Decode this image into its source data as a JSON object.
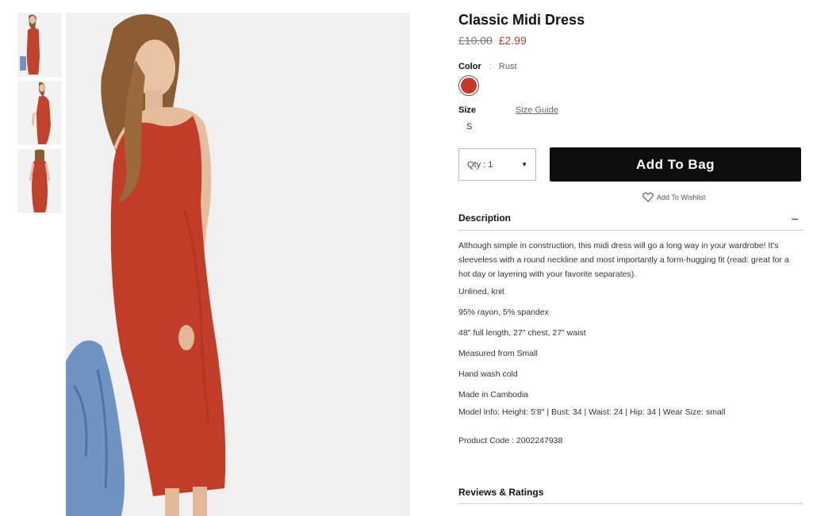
{
  "thumbnails": [
    {
      "alt": "front view"
    },
    {
      "alt": "side view"
    },
    {
      "alt": "back view"
    }
  ],
  "product": {
    "title": "Classic Midi Dress",
    "old_price": "£10.00",
    "new_price": "£2.99",
    "color_label": "Color",
    "color_separator": ":",
    "color_value": "Rust",
    "swatch_color": "#c8372a",
    "size_label": "Size",
    "size_guide": "Size Guide",
    "size_option": "S",
    "qty_label": "Qty : 1",
    "add_to_bag": "Add To Bag",
    "wishlist": "Add To Wishlist"
  },
  "description": {
    "heading": "Description",
    "toggle": "–",
    "intro": "Although simple in construction, this midi dress will go a long way in your wardrobe! It's sleeveless with a round neckline and most importantly a form-hugging fit (read: great for a hot day or layering with your favorite separates).",
    "lines": [
      "Unlined, knit",
      "95% rayon, 5% spandex",
      "48\" full length, 27\" chest, 27\" waist",
      "Measured from Small",
      "Hand wash cold",
      "Made in Cambodia"
    ],
    "model_info": "Model Info: Height: 5'8\" | Bust: 34 | Waist: 24 | Hip: 34 | Wear Size: small",
    "product_code": "Product Code : 2002247938"
  },
  "reviews": {
    "heading": "Reviews & Ratings"
  }
}
